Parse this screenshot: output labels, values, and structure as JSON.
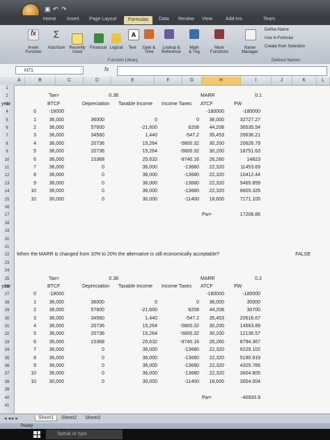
{
  "app": {
    "tabs": [
      "Home",
      "Insert",
      "Page Layout",
      "Formulas",
      "Data",
      "Review",
      "View",
      "Add-Ins",
      "Team"
    ],
    "active_tab": "Formulas"
  },
  "ribbon": {
    "insert_function": "Insert\nFunction",
    "autosum": "AutoSum",
    "recently_used": "Recently\nUsed",
    "financial": "Financial",
    "logical": "Logical",
    "text": "Text",
    "date_time": "Date &\nTime",
    "lookup": "Lookup &\nReference",
    "math": "Math\n& Trig",
    "more": "More\nFunctions",
    "group_function_library": "Function Library",
    "name_manager": "Name\nManager",
    "define_name": "Define Name",
    "use_in_formula": "Use in Formula",
    "create_from_selection": "Create from Selection",
    "group_defined_names": "Defined Names"
  },
  "formula_bar": {
    "name_box": "H71",
    "fx": "fx",
    "value": ""
  },
  "columns": [
    "A",
    "B",
    "C",
    "D",
    "E",
    "F",
    "G",
    "H",
    "I",
    "J",
    "K",
    "L"
  ],
  "selected_column": "H",
  "rows": [
    "1",
    "2",
    "3",
    "4",
    "5",
    "6",
    "7",
    "8",
    "9",
    "10",
    "11",
    "12",
    "13",
    "14",
    "15",
    "16",
    "17",
    "18",
    "19",
    "20",
    "21",
    "22",
    "23",
    "24",
    "25",
    "26",
    "27",
    "28",
    "29",
    "30",
    "31",
    "32",
    "33",
    "34",
    "35",
    "36",
    "37",
    "38",
    "39",
    "40",
    "41"
  ],
  "cells": {
    "t1": {
      "tax_label": "Tax=",
      "tax_value": "0.38",
      "marr_label": "MARR",
      "marr_value": "0.1",
      "h_year": "year",
      "h_btcf": "BTCF",
      "h_dep": "Depreciation",
      "h_ti": "Taxable Income",
      "h_it": "Income Taxes",
      "h_atcf": "ATCF",
      "h_pw": "PW",
      "rows": [
        [
          "0",
          "-18000",
          "",
          "",
          "",
          "-180000",
          "-180000"
        ],
        [
          "1",
          "36,000",
          "36000",
          "0",
          "0",
          "36,000",
          "32727.27"
        ],
        [
          "2",
          "36,000",
          "57600",
          "-21,600",
          "8208",
          "44,208",
          "36535.54"
        ],
        [
          "3",
          "36,000",
          "34560",
          "1,440",
          "-547.2",
          "35,453",
          "26636.21"
        ],
        [
          "4",
          "36,000",
          "20736",
          "15,264",
          "-5800.32",
          "30,200",
          "20626.79"
        ],
        [
          "5",
          "36,000",
          "20736",
          "15,264",
          "-5800.32",
          "30,200",
          "18751.63"
        ],
        [
          "6",
          "36,000",
          "10368",
          "25,632",
          "-9740.16",
          "26,260",
          "14823"
        ],
        [
          "7",
          "36,000",
          "0",
          "36,000",
          "-13680",
          "22,320",
          "11453.69"
        ],
        [
          "8",
          "36,000",
          "0",
          "36,000",
          "-13680",
          "22,320",
          "10412.44"
        ],
        [
          "9",
          "36,000",
          "0",
          "36,000",
          "-13680",
          "22,320",
          "9465.859"
        ],
        [
          "10",
          "36,000",
          "0",
          "36,000",
          "-13680",
          "22,320",
          "8605.326"
        ],
        [
          "10",
          "30,000",
          "0",
          "30,000",
          "-11400",
          "18,600",
          "7171.105"
        ]
      ],
      "pw_label": "Pw=",
      "pw_value": "17208.86"
    },
    "question": "When the MARR is changed from 10% to 20% the alternative is still economically acceptable?",
    "answer": "FALSE",
    "t2": {
      "tax_label": "Tax=",
      "tax_value": "0.38",
      "marr_label": "MARR",
      "marr_value": "0.2",
      "h_year": "year",
      "h_btcf": "BTCF",
      "h_dep": "Depreciation",
      "h_ti": "Taxable Income",
      "h_it": "Income Taxes",
      "h_atcf": "ATCF",
      "h_pw": "PW",
      "rows": [
        [
          "0",
          "-18000",
          "",
          "",
          "",
          "-180000",
          "-180000"
        ],
        [
          "1",
          "36,000",
          "36000",
          "0",
          "0",
          "36,000",
          "30000"
        ],
        [
          "2",
          "36,000",
          "57600",
          "-21,600",
          "8208",
          "44,208",
          "30700"
        ],
        [
          "3",
          "36,000",
          "34560",
          "1,440",
          "-547.2",
          "35,453",
          "20516.67"
        ],
        [
          "4",
          "36,000",
          "20736",
          "15,264",
          "-5800.32",
          "30,200",
          "14563.89"
        ],
        [
          "5",
          "36,000",
          "20736",
          "15,264",
          "-5800.32",
          "30,200",
          "12136.57"
        ],
        [
          "6",
          "36,000",
          "10368",
          "25,632",
          "-9740.16",
          "26,260",
          "8794.367"
        ],
        [
          "7",
          "36,000",
          "0",
          "36,000",
          "-13680",
          "22,320",
          "6229.102"
        ],
        [
          "8",
          "36,000",
          "0",
          "36,000",
          "-13680",
          "22,320",
          "5190.919"
        ],
        [
          "9",
          "36,000",
          "0",
          "36,000",
          "-13680",
          "22,320",
          "4325.766"
        ],
        [
          "10",
          "36,000",
          "0",
          "36,000",
          "-13680",
          "22,320",
          "3604.805"
        ],
        [
          "10",
          "30,000",
          "0",
          "30,000",
          "-11400",
          "18,600",
          "3004.004"
        ]
      ],
      "pw_label": "Pw=",
      "pw_value": "-40933.9"
    }
  },
  "sheets": [
    "Sheet1",
    "Sheet2",
    "Sheet3"
  ],
  "active_sheet": "Sheet1",
  "status": "Ready",
  "taskbar": {
    "search_placeholder": "Speak or type"
  }
}
